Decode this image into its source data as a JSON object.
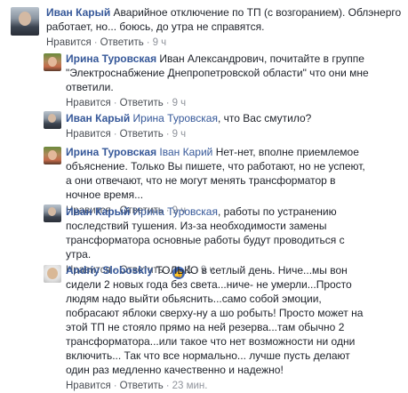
{
  "comments": [
    {
      "author": "Иван Карый",
      "text": "Аварийное отключение по ТП (с возгоранием). Облэнерго работает, но... боюсь, до утра не справятся.",
      "like": "Нравится",
      "reply": "Ответить",
      "time": "9 ч"
    },
    {
      "author": "Ирина Туровская",
      "text": "Иван Александрович, почитайте в группе \"Электроснабжение Днепропетровской области\" что они мне ответили.",
      "like": "Нравится",
      "reply": "Ответить",
      "time": "9 ч"
    },
    {
      "author": "Иван Карый",
      "tag": "Ирина Туровская",
      "text": ", что Вас смутило?",
      "like": "Нравится",
      "reply": "Ответить",
      "time": "9 ч"
    },
    {
      "author": "Ирина Туровская",
      "tag": "Іван Карий",
      "text": " Нет-нет, вполне приемлемое объяснение. Только Вы пишете, что работают, но не успеют, а они отвечают, что не могут менять трансформатор в ночное время...",
      "like": "Нравится",
      "reply": "Ответить",
      "time": "9 ч"
    },
    {
      "author": "Иван Карый",
      "tag": "Ирина Туровская",
      "text": ", работы по устранению последствий тушения. Из-за необходимости замены трансформатора основные работы будут проводиться с утра.",
      "like": "Нравится",
      "reply": "Ответить",
      "reactions": "1",
      "time": "9 ч"
    },
    {
      "author": "Andriy Sloboskiy",
      "text": "ТОЛЬКО в сетлый день. Ниче...мы вон сидели 2 новых года без света...ниче- не умерли...Просто людям надо выйти обьяснить...само собой эмоции, побрасают яблоки сверху-ну а шо робыть! Просто может на этой ТП не стояло прямо на ней резерва...там обычно 2 трансформатора...или такое что нет возможности ни одни включить... Так что все нормально... лучше пусть делают один раз медленно качественно и надежно!",
      "like": "Нравится",
      "reply": "Ответить",
      "time": "23 мин."
    }
  ],
  "icons": {
    "avatar_ivan": "avatar-ivan",
    "avatar_irina": "avatar-irina",
    "avatar_andriy": "avatar-andriy",
    "reaction": "like-reaction-icon"
  },
  "colors": {
    "name": "#365899",
    "meta": "#90949c",
    "reaction": "#4267b2"
  }
}
